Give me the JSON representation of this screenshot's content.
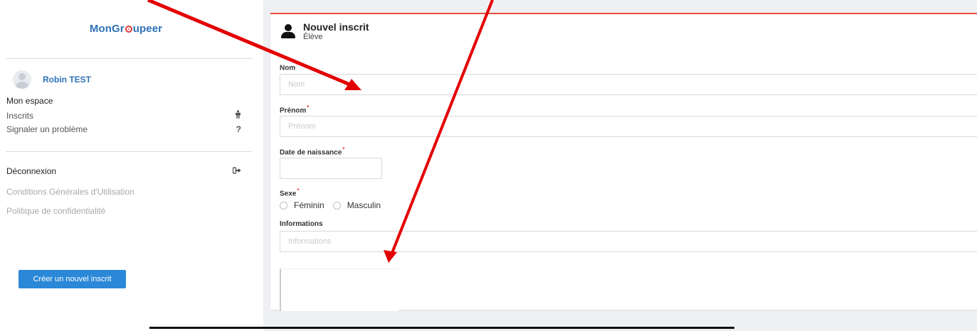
{
  "sidebar": {
    "logo": {
      "part1": "MonGr",
      "part2": "upeer"
    },
    "user_name": "Robin TEST",
    "section_title": "Mon espace",
    "nav": [
      {
        "label": "Inscrits",
        "icon": "person-standing-icon"
      },
      {
        "label": "Signaler un problème",
        "icon": "question-icon"
      }
    ],
    "logout": {
      "label": "Déconnexion",
      "icon": "sign-out-icon"
    },
    "footer_links": [
      "Conditions Générales d'Utilisation",
      "Politique de confidentialité"
    ]
  },
  "form": {
    "title": "Nouvel inscrit",
    "subtitle": "Élève",
    "fields": {
      "nom": {
        "label": "Nom",
        "placeholder": "Nom",
        "value": ""
      },
      "prenom": {
        "label": "Prénom",
        "placeholder": "Prénom",
        "value": ""
      },
      "date": {
        "label": "Date de naissance",
        "value": ""
      },
      "sexe": {
        "label": "Sexe",
        "options": [
          "Féminin",
          "Masculin"
        ]
      },
      "info": {
        "label": "Informations",
        "placeholder": "Informations",
        "value": ""
      }
    },
    "required_mark": "*",
    "submit_label": "Créer un nouvel inscrit"
  },
  "colors": {
    "brand_blue": "#2f72b8",
    "button_blue": "#2b88d8",
    "card_top_border": "#e74c3c",
    "annotation_red": "#e30000"
  }
}
